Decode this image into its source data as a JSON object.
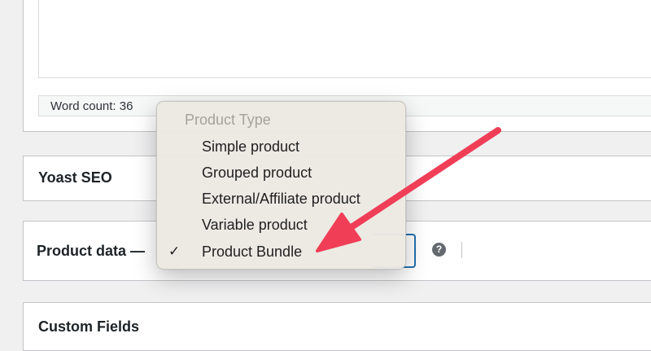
{
  "editor": {
    "word_count": "Word count: 36"
  },
  "yoast": {
    "title": "Yoast SEO"
  },
  "product_data": {
    "title": "Product data —",
    "help_glyph": "?"
  },
  "custom_fields": {
    "title": "Custom Fields"
  },
  "dropdown": {
    "header": "Product Type",
    "selected": "Product Bundle",
    "checkmark": "✓",
    "options": [
      {
        "label": "Simple product"
      },
      {
        "label": "Grouped product"
      },
      {
        "label": "External/Affiliate product"
      },
      {
        "label": "Variable product"
      },
      {
        "label": "Product Bundle"
      }
    ]
  },
  "colors": {
    "accent": "#2271b1",
    "arrow": "#f03e57"
  },
  "icons": {
    "help": "help-circle-icon",
    "check": "checkmark-icon",
    "annotation": "red-arrow"
  }
}
